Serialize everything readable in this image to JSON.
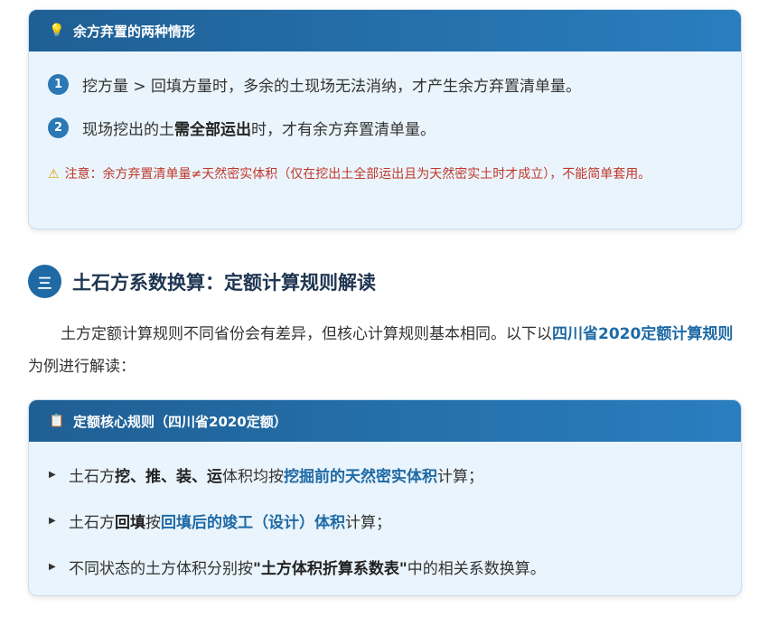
{
  "card1": {
    "title": "余方弃置的两种情形",
    "icon": "lightbulb-icon",
    "items": [
      {
        "num": "1",
        "text": "挖方量 > 回填方量时，多余的土现场无法消纳，才产生余方弃置清单量。"
      },
      {
        "num": "2",
        "pre": "现场挖出的土",
        "bold": "需全部运出",
        "post": "时，才有余方弃置清单量。"
      }
    ],
    "warning": "注意：余方弃置清单量≠天然密实体积（仅在挖出土全部运出且为天然密实土时才成立），不能简单套用。"
  },
  "section": {
    "badge": "三",
    "title": "土石方系数换算：定额计算规则解读"
  },
  "para": {
    "pre": "土方定额计算规则不同省份会有差异，但核心计算规则基本相同。以下以",
    "highlight": "四川省2020定额计算规则",
    "post": "为例进行解读："
  },
  "card2": {
    "title": "定额核心规则（四川省2020定额）",
    "icon": "clipboard-icon",
    "b1": {
      "pre": "土石方",
      "bold": "挖、推、装、运",
      "mid": "体积均按",
      "hl": "挖掘前的天然密实体积",
      "post": "计算；"
    },
    "b2": {
      "pre": "土石方",
      "bold": "回填",
      "mid": "按",
      "hl": "回填后的竣工（设计）体积",
      "post": "计算；"
    },
    "b3": {
      "pre": "不同状态的土方体积分别按",
      "bold": "\"土方体积折算系数表\"",
      "post": "中的相关系数换算。"
    }
  },
  "colors": {
    "header_start": "#1f5f94",
    "header_end": "#2a7ebf",
    "card_bg": "#eaf4fc",
    "accent": "#1f6aa5",
    "warning": "#c0392b"
  }
}
